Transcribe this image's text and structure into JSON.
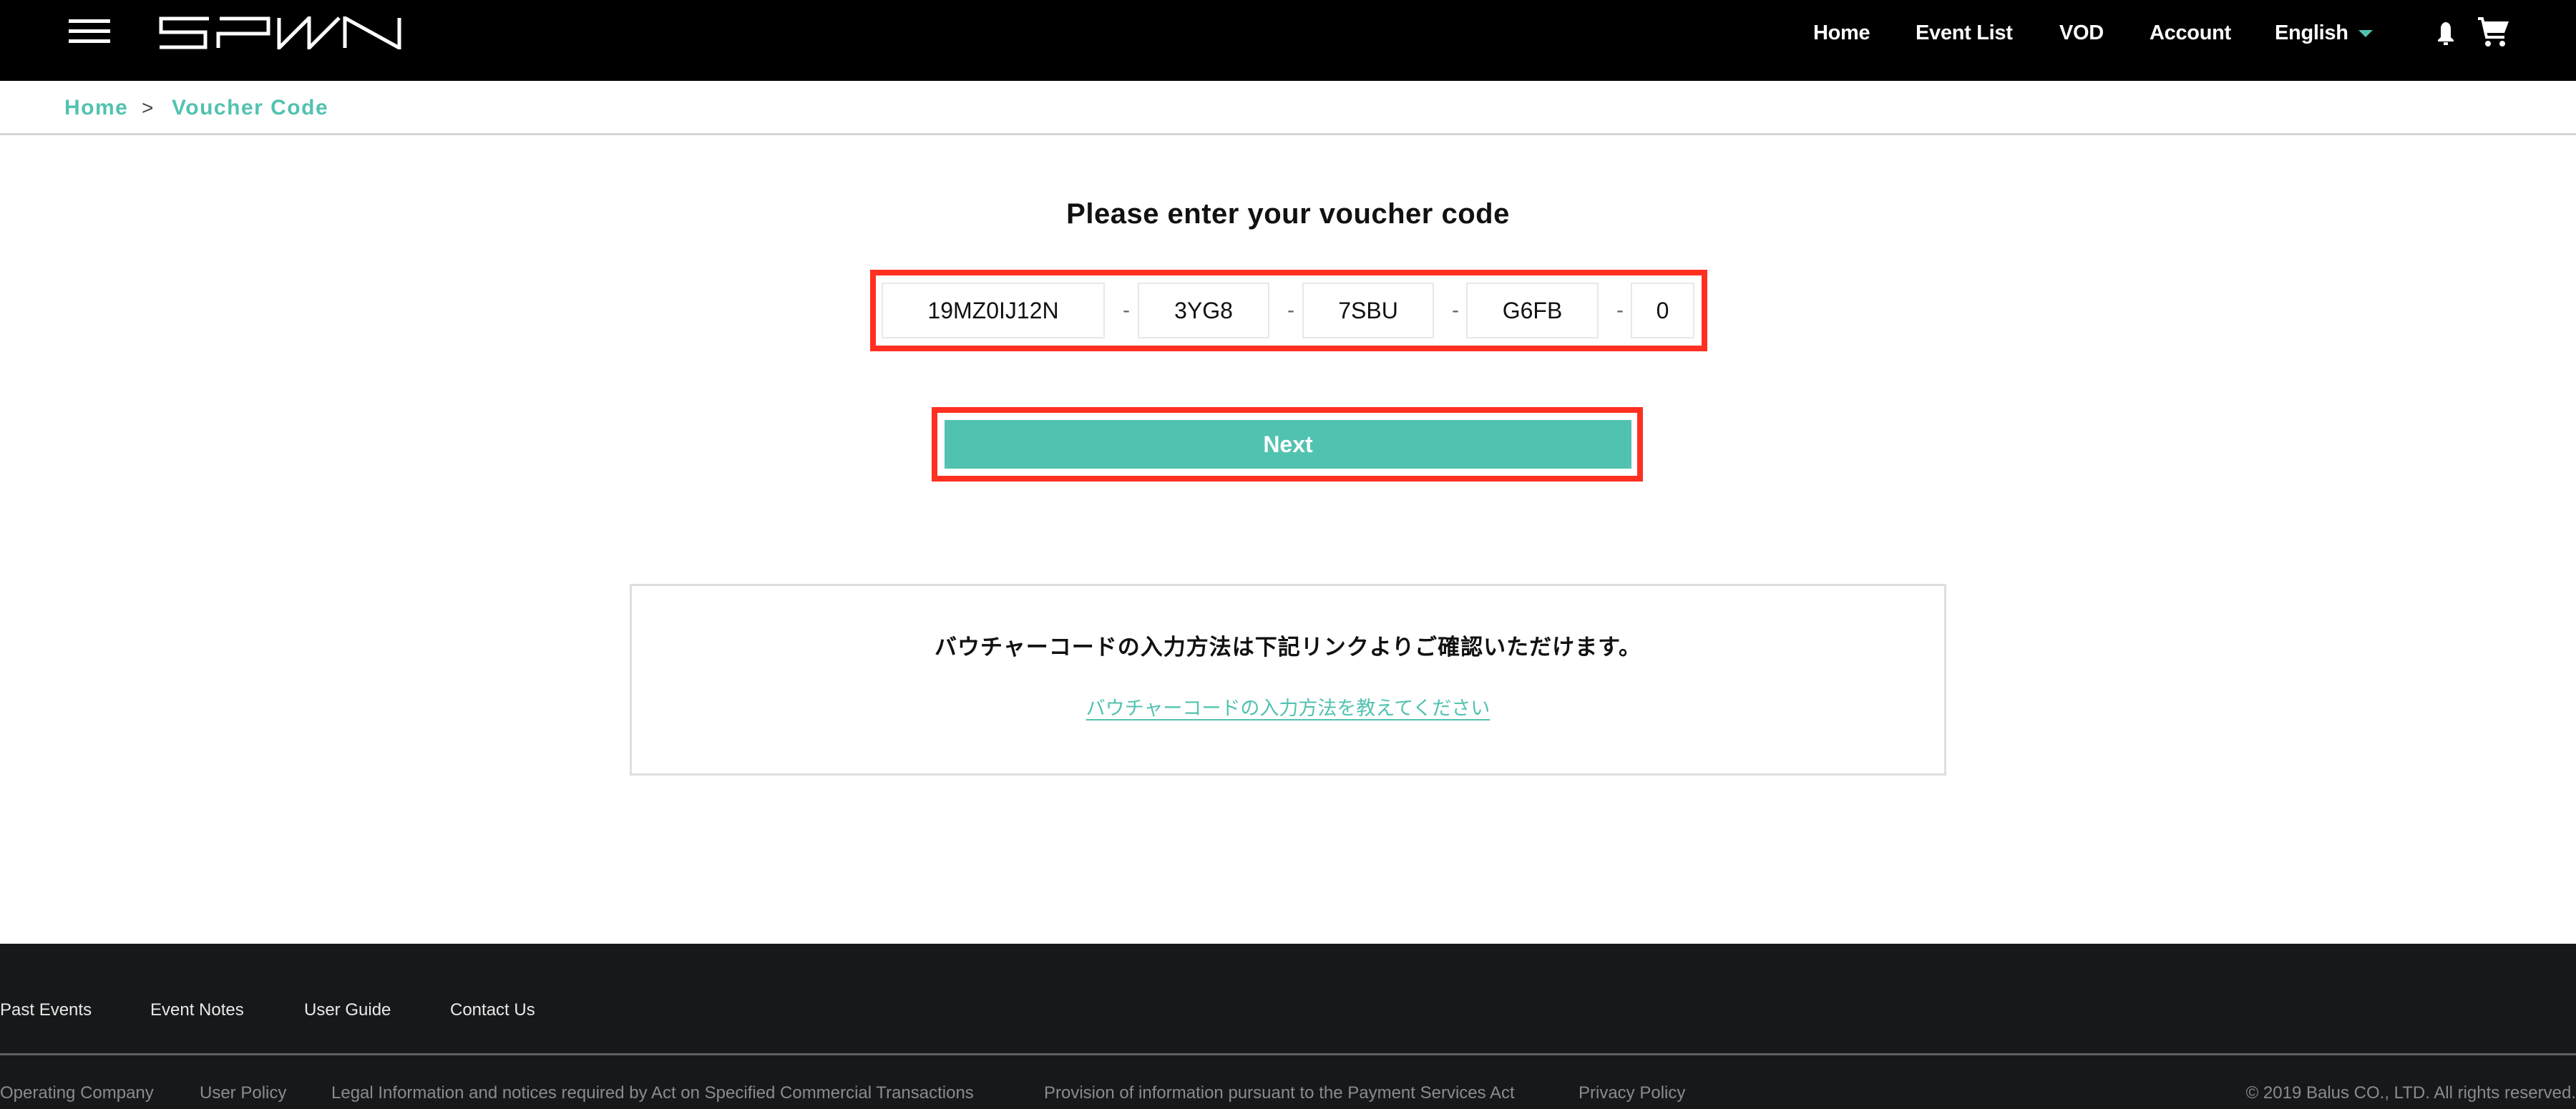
{
  "header": {
    "brand": "SPWN",
    "nav": [
      {
        "label": "Home"
      },
      {
        "label": "Event List"
      },
      {
        "label": "VOD"
      },
      {
        "label": "Account"
      }
    ],
    "language": {
      "selected": "English"
    },
    "icons": {
      "menu": "hamburger-menu-icon",
      "notifications": "bell-icon",
      "cart": "cart-icon"
    }
  },
  "breadcrumb": {
    "items": [
      "Home",
      "Voucher Code"
    ],
    "separator": ">"
  },
  "main": {
    "heading": "Please enter your voucher code",
    "code_segments": [
      "19MZ0IJ12N",
      "3YG8",
      "7SBU",
      "G6FB",
      "0"
    ],
    "segment_separator": "-",
    "next_label": "Next",
    "info": {
      "text": "バウチャーコードの入力方法は下記リンクよりご確認いただけます。",
      "link": "バウチャーコードの入力方法を教えてください"
    }
  },
  "footer": {
    "links": [
      "Past Events",
      "Event Notes",
      "User Guide",
      "Contact Us"
    ],
    "legal_links": [
      "Operating Company",
      "User Policy",
      "Legal Information and notices required by Act on Specified Commercial Transactions",
      "Provision of information pursuant to the Payment Services Act",
      "Privacy Policy"
    ],
    "copyright": "© 2019 Balus CO., LTD. All rights reserved."
  },
  "colors": {
    "accent": "#52c2b0",
    "highlight": "#ff3021",
    "header_bg": "#000000",
    "footer_bg": "#17181a"
  }
}
